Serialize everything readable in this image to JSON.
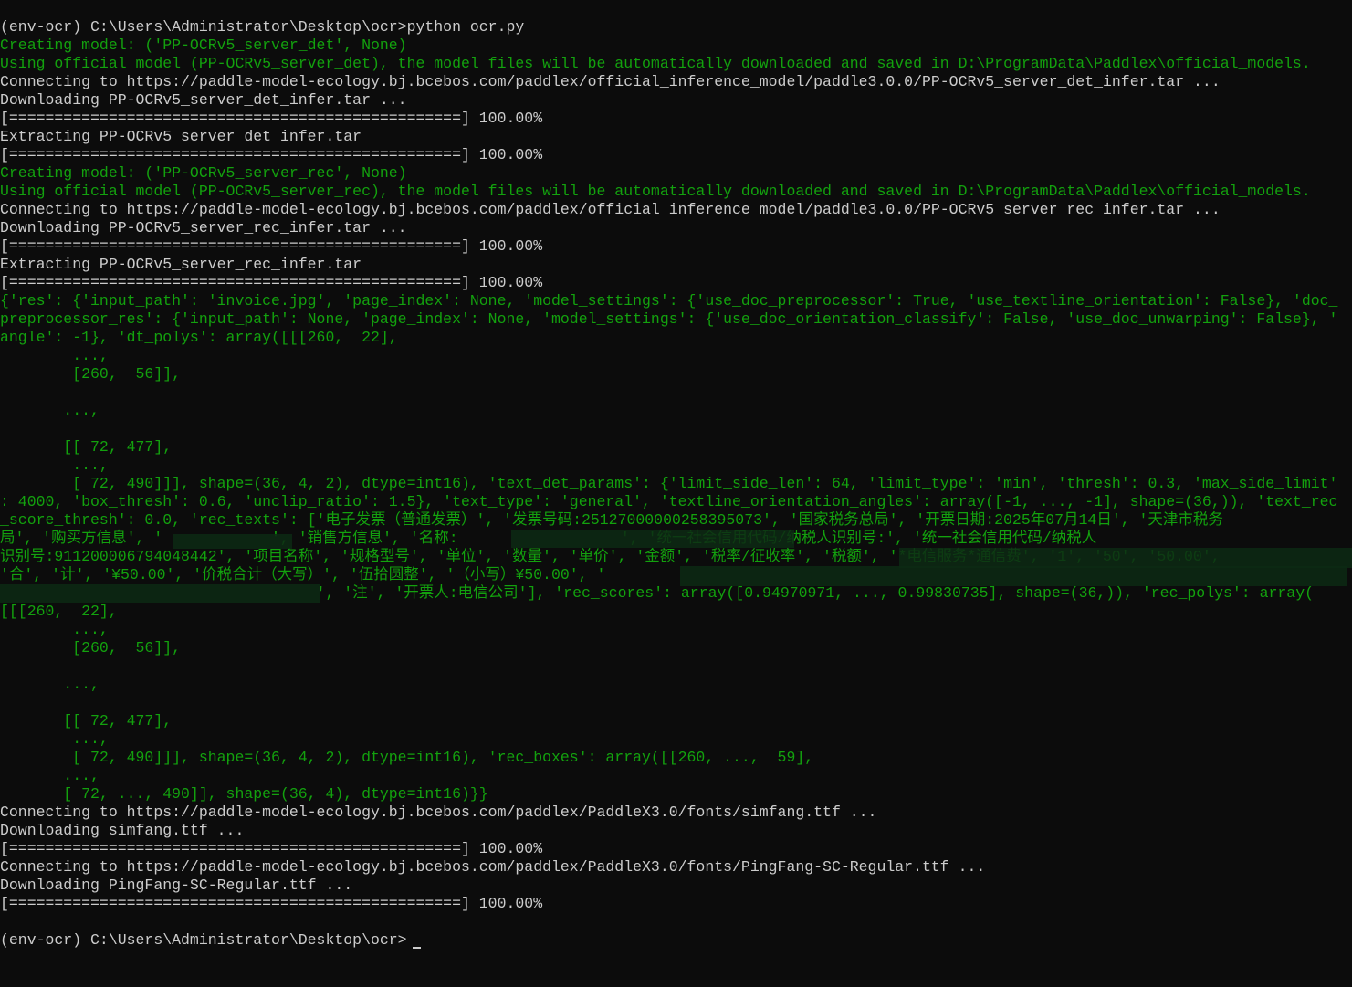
{
  "window": {
    "title": "(env-ocr) C:\\Users\\Administrator\\Desktop\\ocr",
    "colors": {
      "background": "#0c0c0c",
      "text": "#cccccc",
      "green": "#13a10e"
    }
  },
  "terminal": {
    "prompt": "(env-ocr) C:\\Users\\Administrator\\Desktop\\ocr>",
    "command": "python ocr.py",
    "lines": [
      {
        "text": "(env-ocr) C:\\Users\\Administrator\\Desktop\\ocr>python ocr.py",
        "color": "white"
      },
      {
        "text": "Creating model: ('PP-OCRv5_server_det', None)",
        "color": "green"
      },
      {
        "text": "Using official model (PP-OCRv5_server_det), the model files will be automatically downloaded and saved in D:\\ProgramData\\Paddlex\\official_models.",
        "color": "green"
      },
      {
        "text": "Connecting to https://paddle-model-ecology.bj.bcebos.com/paddlex/official_inference_model/paddle3.0.0/PP-OCRv5_server_det_infer.tar ...",
        "color": "white"
      },
      {
        "text": "Downloading PP-OCRv5_server_det_infer.tar ...",
        "color": "white"
      },
      {
        "text": "[==================================================] 100.00%",
        "color": "white"
      },
      {
        "text": "Extracting PP-OCRv5_server_det_infer.tar",
        "color": "white"
      },
      {
        "text": "[==================================================] 100.00%",
        "color": "white"
      },
      {
        "text": "Creating model: ('PP-OCRv5_server_rec', None)",
        "color": "green"
      },
      {
        "text": "Using official model (PP-OCRv5_server_rec), the model files will be automatically downloaded and saved in D:\\ProgramData\\Paddlex\\official_models.",
        "color": "green"
      },
      {
        "text": "Connecting to https://paddle-model-ecology.bj.bcebos.com/paddlex/official_inference_model/paddle3.0.0/PP-OCRv5_server_rec_infer.tar ...",
        "color": "white"
      },
      {
        "text": "Downloading PP-OCRv5_server_rec_infer.tar ...",
        "color": "white"
      },
      {
        "text": "[==================================================] 100.00%",
        "color": "white"
      },
      {
        "text": "Extracting PP-OCRv5_server_rec_infer.tar",
        "color": "white"
      },
      {
        "text": "[==================================================] 100.00%",
        "color": "white"
      },
      {
        "text": "{'res': {'input_path': 'invoice.jpg', 'page_index': None, 'model_settings': {'use_doc_preprocessor': True, 'use_textline_orientation': False}, 'doc_",
        "color": "green"
      },
      {
        "text": "preprocessor_res': {'input_path': None, 'page_index': None, 'model_settings': {'use_doc_orientation_classify': False, 'use_doc_unwarping': False}, '",
        "color": "green"
      },
      {
        "text": "angle': -1}, 'dt_polys': array([[[260,  22],",
        "color": "green"
      },
      {
        "text": "        ...,",
        "color": "green"
      },
      {
        "text": "        [260,  56]],",
        "color": "green"
      },
      {
        "text": "",
        "color": "green"
      },
      {
        "text": "       ...,",
        "color": "green"
      },
      {
        "text": "",
        "color": "green"
      },
      {
        "text": "       [[ 72, 477],",
        "color": "green"
      },
      {
        "text": "        ...,",
        "color": "green"
      },
      {
        "text": "        [ 72, 490]]], shape=(36, 4, 2), dtype=int16), 'text_det_params': {'limit_side_len': 64, 'limit_type': 'min', 'thresh': 0.3, 'max_side_limit'",
        "color": "green"
      },
      {
        "text": ": 4000, 'box_thresh': 0.6, 'unclip_ratio': 1.5}, 'text_type': 'general', 'textline_orientation_angles': array([-1, ..., -1], shape=(36,)), 'text_rec",
        "color": "green"
      },
      {
        "text": "_score_thresh': 0.0, 'rec_texts': ['电子发票（普通发票）', '发票号码:25127000000258395073', '国家税务总局', '开票日期:2025年07月14日', '天津市税务",
        "color": "green"
      },
      {
        "text": "局', '购买方信息', '            ', '销售方信息', '名称:                  ', '统一社会信用代码/纳税人识别号:', '统一社会信用代码/纳税人",
        "color": "green"
      },
      {
        "text": "识别号:911200006794048442', '项目名称', '规格型号', '单位', '数量', '单价', '金额', '税率/征收率', '税额', '*电信服务*通信费', '1', '50', '50.00',",
        "color": "green"
      },
      {
        "text": "'合', '计', '¥50.00', '价税合计（大写）', '伍拾圆整', '（小写）¥50.00', '",
        "color": "green"
      },
      {
        "text": "                                   ', '注', '开票人:电信公司'], 'rec_scores': array([0.94970971, ..., 0.99830735], shape=(36,)), 'rec_polys': array(",
        "color": "green"
      },
      {
        "text": "[[[260,  22],",
        "color": "green"
      },
      {
        "text": "        ...,",
        "color": "green"
      },
      {
        "text": "        [260,  56]],",
        "color": "green"
      },
      {
        "text": "",
        "color": "green"
      },
      {
        "text": "       ...,",
        "color": "green"
      },
      {
        "text": "",
        "color": "green"
      },
      {
        "text": "       [[ 72, 477],",
        "color": "green"
      },
      {
        "text": "        ...,",
        "color": "green"
      },
      {
        "text": "        [ 72, 490]]], shape=(36, 4, 2), dtype=int16), 'rec_boxes': array([[260, ...,  59],",
        "color": "green"
      },
      {
        "text": "       ...,",
        "color": "green"
      },
      {
        "text": "       [ 72, ..., 490]], shape=(36, 4), dtype=int16)}}",
        "color": "green"
      },
      {
        "text": "Connecting to https://paddle-model-ecology.bj.bcebos.com/paddlex/PaddleX3.0/fonts/simfang.ttf ...",
        "color": "white"
      },
      {
        "text": "Downloading simfang.ttf ...",
        "color": "white"
      },
      {
        "text": "[==================================================] 100.00%",
        "color": "white"
      },
      {
        "text": "Connecting to https://paddle-model-ecology.bj.bcebos.com/paddlex/PaddleX3.0/fonts/PingFang-SC-Regular.ttf ...",
        "color": "white"
      },
      {
        "text": "Downloading PingFang-SC-Regular.ttf ...",
        "color": "white"
      },
      {
        "text": "[==================================================] 100.00%",
        "color": "white"
      },
      {
        "text": "",
        "color": "white"
      },
      {
        "text": "(env-ocr) C:\\Users\\Administrator\\Desktop\\ocr>",
        "color": "white"
      }
    ]
  }
}
